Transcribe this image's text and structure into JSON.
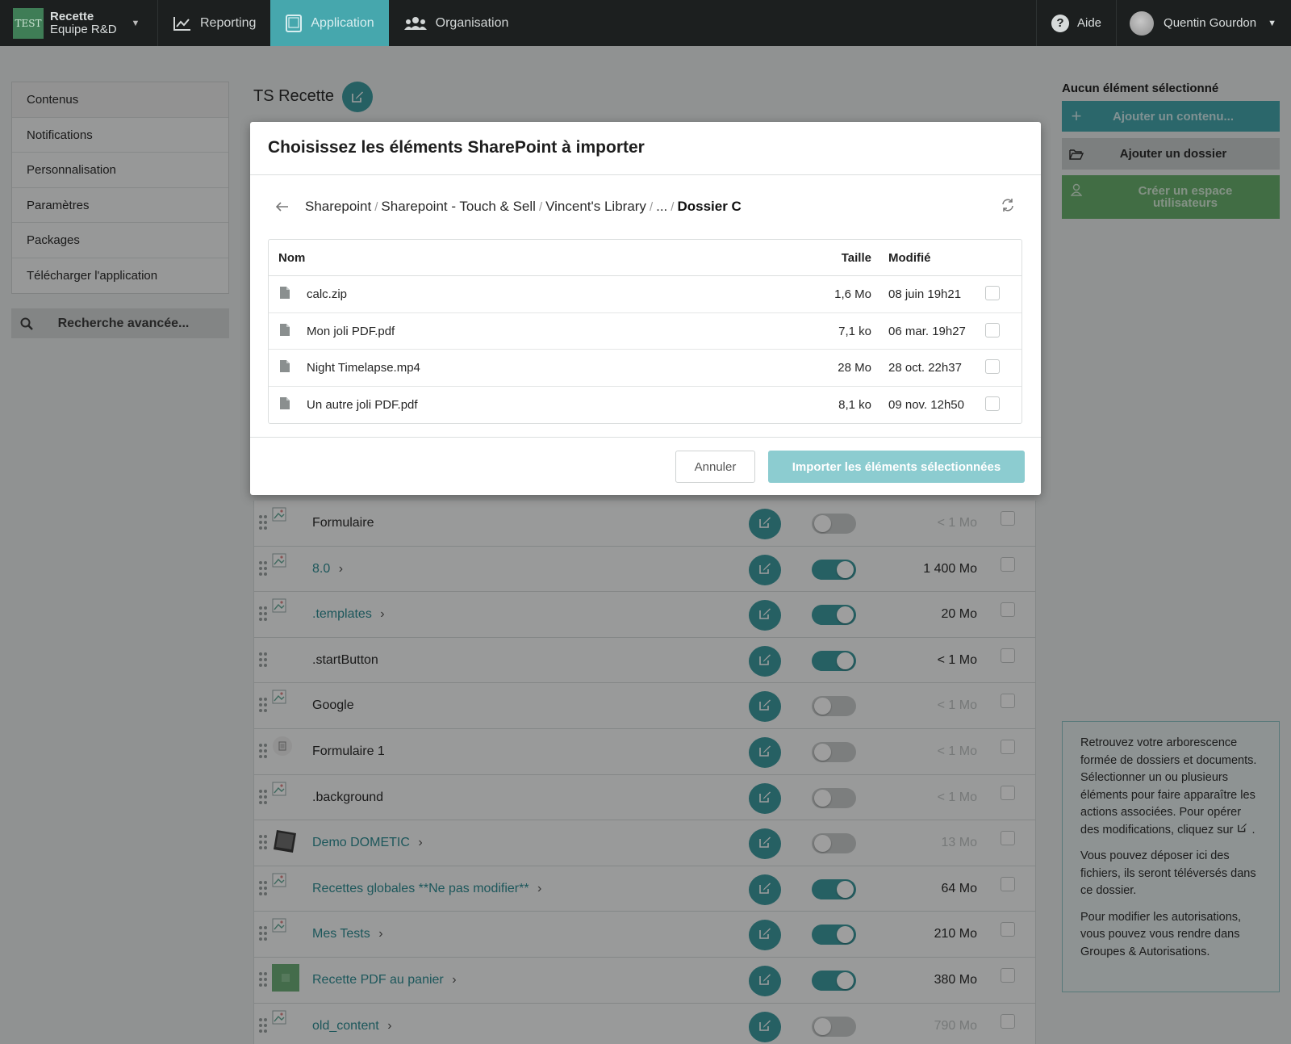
{
  "topbar": {
    "brand_logo": "TEST",
    "brand_line1": "Recette",
    "brand_line2": "Equipe R&D",
    "nav": [
      {
        "label": "Reporting",
        "icon": "chart-line-icon"
      },
      {
        "label": "Application",
        "icon": "tablet-icon",
        "active": true
      },
      {
        "label": "Organisation",
        "icon": "users-icon"
      }
    ],
    "help_label": "Aide",
    "user_name": "Quentin Gourdon"
  },
  "sidebar": {
    "items": [
      {
        "label": "Contenus",
        "active": true
      },
      {
        "label": "Notifications"
      },
      {
        "label": "Personnalisation"
      },
      {
        "label": "Paramètres"
      },
      {
        "label": "Packages"
      },
      {
        "label": "Télécharger l'application"
      }
    ],
    "search_label": "Recherche avancée..."
  },
  "main": {
    "title": "TS Recette",
    "rows": [
      {
        "name": "Formulaire",
        "folder": false,
        "enabled": false,
        "size": "< 1 Mo"
      },
      {
        "name": "8.0",
        "folder": true,
        "enabled": true,
        "size": "1 400 Mo"
      },
      {
        "name": ".templates",
        "folder": true,
        "enabled": true,
        "size": "20 Mo"
      },
      {
        "name": ".startButton",
        "folder": false,
        "enabled": true,
        "size": "< 1 Mo"
      },
      {
        "name": "Google",
        "folder": false,
        "enabled": false,
        "size": "< 1 Mo"
      },
      {
        "name": "Formulaire 1",
        "folder": false,
        "enabled": false,
        "size": "< 1 Mo"
      },
      {
        "name": ".background",
        "folder": false,
        "enabled": false,
        "size": "< 1 Mo"
      },
      {
        "name": "Demo DOMETIC",
        "folder": true,
        "enabled": false,
        "size": "13 Mo"
      },
      {
        "name": "Recettes globales **Ne pas modifier**",
        "folder": true,
        "enabled": true,
        "size": "64 Mo"
      },
      {
        "name": "Mes Tests",
        "folder": true,
        "enabled": true,
        "size": "210 Mo"
      },
      {
        "name": "Recette PDF au panier",
        "folder": true,
        "enabled": true,
        "size": "380 Mo"
      },
      {
        "name": "old_content",
        "folder": true,
        "enabled": false,
        "size": "790 Mo"
      }
    ]
  },
  "right_panel": {
    "title": "Aucun élément sélectionné",
    "add_content": "Ajouter un contenu...",
    "add_folder": "Ajouter un dossier",
    "create_space": "Créer un espace utilisateurs",
    "info": [
      "Retrouvez votre arborescence formée de dossiers et documents. Sélectionner un ou plusieurs éléments pour faire apparaître les actions associées. Pour opérer des modifications, cliquez sur",
      "Vous pouvez déposer ici des fichiers, ils seront téléversés dans ce dossier.",
      "Pour modifier les autorisations, vous pouvez vous rendre dans Groupes & Autorisations."
    ]
  },
  "modal": {
    "title": "Choisissez les éléments SharePoint à importer",
    "breadcrumb": [
      "Sharepoint",
      "Sharepoint - Touch & Sell",
      "Vincent's Library",
      "..."
    ],
    "breadcrumb_current": "Dossier C",
    "columns": {
      "name": "Nom",
      "size": "Taille",
      "modified": "Modifié"
    },
    "files": [
      {
        "name": "calc.zip",
        "size": "1,6 Mo",
        "modified": "08 juin 19h21"
      },
      {
        "name": "Mon joli PDF.pdf",
        "size": "7,1 ko",
        "modified": "06 mar. 19h27"
      },
      {
        "name": "Night Timelapse.mp4",
        "size": "28 Mo",
        "modified": "28 oct. 22h37"
      },
      {
        "name": "Un autre joli PDF.pdf",
        "size": "8,1 ko",
        "modified": "09 nov. 12h50"
      }
    ],
    "cancel_label": "Annuler",
    "import_label": "Importer les éléments sélectionnées"
  }
}
